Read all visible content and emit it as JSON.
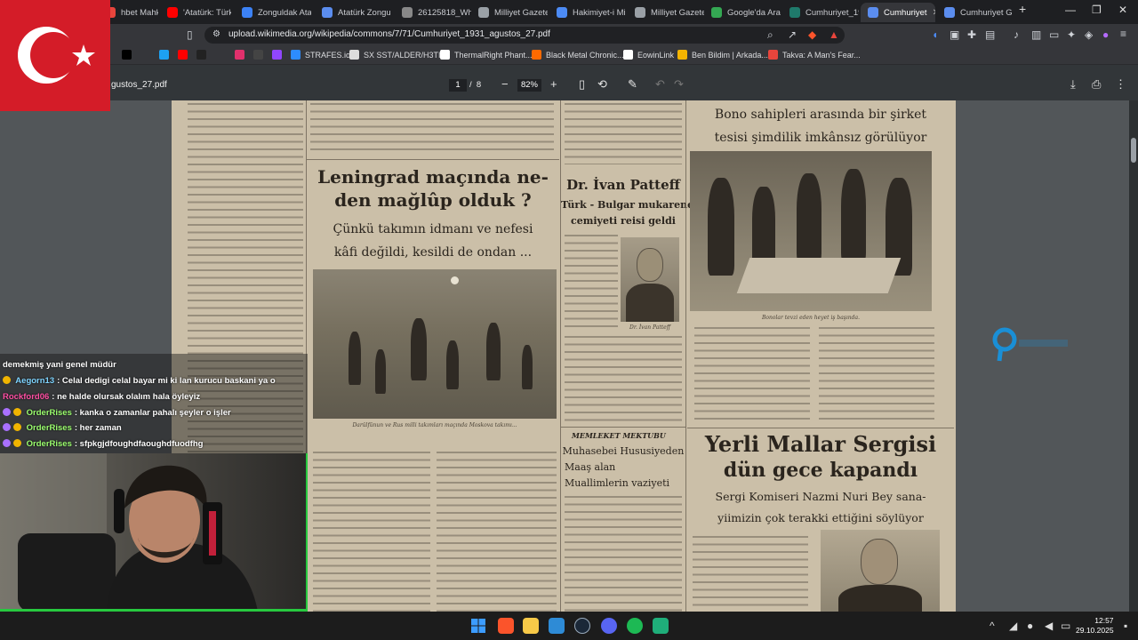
{
  "browser": {
    "tabs": [
      {
        "title": "hbet Mahkem",
        "color": "#e8453c"
      },
      {
        "title": "'Atatürk: Türkle",
        "color": "#ff0000"
      },
      {
        "title": "Zonguldak Ata",
        "color": "#3c82f6"
      },
      {
        "title": "Atatürk Zongul",
        "color": "#5b8def"
      },
      {
        "title": "26125818_Whe",
        "color": "#888888"
      },
      {
        "title": "Milliyet Gazete",
        "color": "#9aa0a6"
      },
      {
        "title": "Hakimiyet-i Mil",
        "color": "#4c8bf5"
      },
      {
        "title": "Milliyet Gazete",
        "color": "#9aa0a6"
      },
      {
        "title": "Google'da Ara",
        "color": "#34a853"
      },
      {
        "title": "Cumhuriyet_19",
        "color": "#1f7a6b"
      },
      {
        "title": "Cumhuriyet",
        "color": "#5b8def",
        "active": true
      },
      {
        "title": "Cumhuriyet Ga",
        "color": "#5b8def"
      }
    ],
    "new_tab": "+",
    "url": "upload.wikimedia.org/wikipedia/commons/7/71/Cumhuriyet_1931_agustos_27.pdf",
    "bookmarks": [
      {
        "label": "",
        "color": "#000000"
      },
      {
        "label": "",
        "color": "#1da1f2"
      },
      {
        "label": "",
        "color": "#ff0000"
      },
      {
        "label": "",
        "color": "#222222"
      },
      {
        "label": "",
        "color": "#e1306c"
      },
      {
        "label": "",
        "color": "#444444"
      },
      {
        "label": "",
        "color": "#9146ff"
      },
      {
        "label": "STRAFES.io",
        "color": "#2d8cff"
      },
      {
        "label": "SX SST/ALDER/H3TI...",
        "color": "#dddddd"
      },
      {
        "label": "ThermalRight Phant...",
        "color": "#ffffff"
      },
      {
        "label": "Black Metal Chronic...",
        "color": "#ff6a00"
      },
      {
        "label": "EowinLink",
        "color": "#ffffff"
      },
      {
        "label": "Ben Bildim | Arkada...",
        "color": "#f4b400"
      },
      {
        "label": "Takva: A Man's Fear...",
        "color": "#e8453c"
      }
    ]
  },
  "pdf": {
    "filename": "gustos_27.pdf",
    "page_current": "1",
    "page_separator": "/",
    "page_total": "8",
    "zoom": "82%"
  },
  "newspaper": {
    "col2_headline_1": "Leningrad maçında ne-",
    "col2_headline_2": "den mağlûp olduk ?",
    "col2_sub_1": "Çünkü takımın idmanı ve nefesi",
    "col2_sub_2": "kâfi değildi, kesildi de ondan ...",
    "col3_headline": "Dr. İvan Patteff",
    "col3_sub_1": "Türk - Bulgar mukarenet",
    "col3_sub_2": "cemiyeti reisi geldi",
    "col3_photo_caption": "Dr. İvan Patteff",
    "col3_section": "MEMLEKET MEKTUBU",
    "col3_article_1": "Muhasebei Hususiyeden",
    "col3_article_2": "Maaş alan",
    "col3_article_3": "Muallimlerin vaziyeti",
    "col4_headline_1": "Bono sahipleri arasında bir şirket",
    "col4_headline_2": "tesisi şimdilik imkânsız görülüyor",
    "col4_photo_caption": "Bonolar tevzi eden heyet iş başında.",
    "col4_big_1": "Yerli Mallar Sergisi",
    "col4_big_2": "dün gece kapandı",
    "col4_sub_1": "Sergi Komiseri Nazmi Nuri Bey sana-",
    "col4_sub_2": "yiimizin çok terakki ettiğini söylüyor",
    "col2_photo_caption": "Darülfünun ve Rus milli takımları maçında Moskova takımı..."
  },
  "chat": [
    {
      "user": "",
      "text": "demekmiş yani genel müdür",
      "color": "#ffffff",
      "badge": ""
    },
    {
      "user": "Aegorn13",
      "text": ": Celal dedigi celal bayar mi ki lan kurucu baskani ya o",
      "color": "#7fd4ff",
      "badge": "#f0b400"
    },
    {
      "user": "Rockford06",
      "text": ": ne halde olursak olalım hala öyleyiz",
      "color": "#ff4fa3",
      "badge": ""
    },
    {
      "user": "OrderRises",
      "text": ": kanka o zamanlar pahalı şeyler o işler",
      "color": "#9cff6f",
      "badge": "#a970ff"
    },
    {
      "user": "OrderRises",
      "text": ": her zaman",
      "color": "#9cff6f",
      "badge": "#a970ff"
    },
    {
      "user": "OrderRises",
      "text": ": sfpkgjdfoughdfaoughdfuodfhg",
      "color": "#9cff6f",
      "badge": "#a970ff"
    }
  ],
  "taskbar": {
    "time": "12:57",
    "date": "29.10.2025",
    "apps": [
      {
        "name": "windows",
        "color": "#3c9cff"
      },
      {
        "name": "brave",
        "color": "#fb542b"
      },
      {
        "name": "files",
        "color": "#f7c948"
      },
      {
        "name": "photos",
        "color": "#2e8bd6"
      },
      {
        "name": "steam",
        "color": "#1b2838"
      },
      {
        "name": "discord",
        "color": "#5865f2"
      },
      {
        "name": "spotify",
        "color": "#1db954"
      },
      {
        "name": "app",
        "color": "#1fae7a"
      }
    ]
  }
}
